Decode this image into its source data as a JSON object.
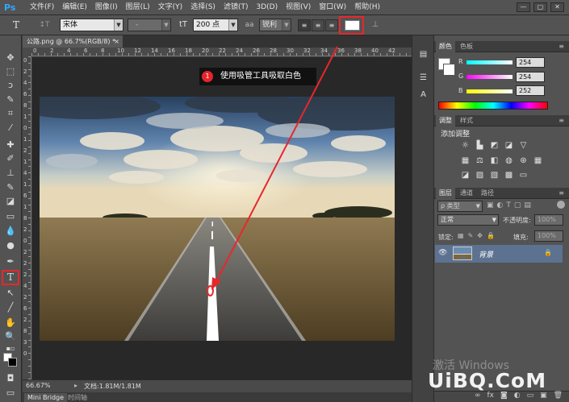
{
  "app": {
    "logo": "Ps"
  },
  "menu": {
    "items": [
      "文件(F)",
      "编辑(E)",
      "图像(I)",
      "图层(L)",
      "文字(Y)",
      "选择(S)",
      "滤镜(T)",
      "3D(D)",
      "视图(V)",
      "窗口(W)",
      "帮助(H)"
    ]
  },
  "window_controls": [
    "—",
    "▢",
    "✕"
  ],
  "options": {
    "tool_icon": "T",
    "orient_icon": "↕T",
    "font_family": "宋体",
    "font_style": "-",
    "font_size_icon": "tT",
    "font_size": "200 点",
    "aa_icon": "aa",
    "antialias": "锐利",
    "warp_icon": "⊥",
    "text_color": "#ffffff"
  },
  "document": {
    "tab_title": "公路.png @ 66.7%(RGB/8) *",
    "tab_close": "×",
    "zoom": "66.67%",
    "doc_size": "文档:1.81M/1.81M",
    "ruler_top": [
      "0",
      "2",
      "4",
      "6",
      "8",
      "10",
      "12",
      "14",
      "16",
      "18",
      "20",
      "22",
      "24",
      "26",
      "28",
      "30",
      "32",
      "34",
      "36",
      "38",
      "40",
      "42"
    ],
    "ruler_left": [
      "0",
      "2",
      "4",
      "6",
      "8",
      "1",
      "0",
      "1",
      "2",
      "1",
      "4",
      "1",
      "6",
      "1",
      "8",
      "2",
      "0",
      "2",
      "2",
      "2",
      "4",
      "2",
      "6",
      "2",
      "8",
      "3",
      "0"
    ]
  },
  "annotation": {
    "step": "1",
    "text": "使用吸管工具吸取白色",
    "color": "#e8272b"
  },
  "bottom_tabs": [
    "Mini Bridge",
    "时间轴"
  ],
  "panels": {
    "color_tabs": [
      "颜色",
      "色板"
    ],
    "color": {
      "r_label": "R",
      "r": "254",
      "g_label": "G",
      "g": "254",
      "b_label": "B",
      "b": "252"
    },
    "adjust_tabs": [
      "调整",
      "样式"
    ],
    "adjust_title": "添加调整",
    "layers_tabs": [
      "图层",
      "通道",
      "路径"
    ],
    "layer_filter": "ρ 类型",
    "blend_mode": "正常",
    "opacity_label": "不透明度:",
    "opacity": "100%",
    "lock_label": "锁定:",
    "fill_label": "填充:",
    "fill": "100%",
    "layer_name": "背景",
    "eye_icon": "👁",
    "lock_icon": "🔒"
  },
  "watermark": {
    "activate": "激活 Windows",
    "site": "UiBQ.CoM"
  }
}
